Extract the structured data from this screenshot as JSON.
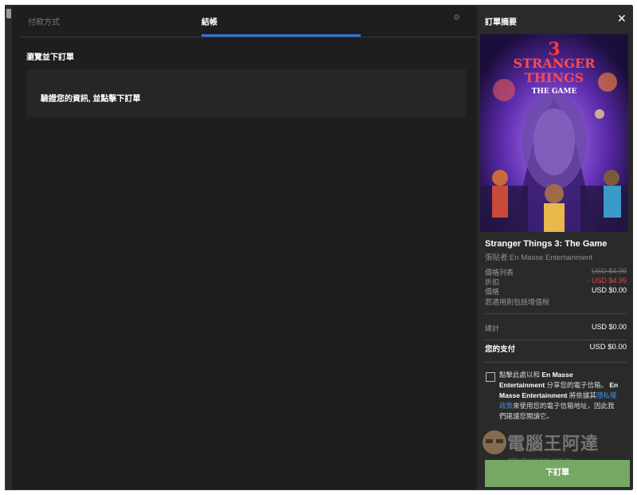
{
  "tabs": {
    "payment_method": "付款方式",
    "checkout": "結帳"
  },
  "main": {
    "section_title": "瀏覽並下訂單",
    "verify_text": "驗證您的資訊, 並點擊下訂單"
  },
  "sidebar": {
    "title": "訂單摘要",
    "close_icon": "close-icon",
    "game_title": "Stranger Things 3: The Game",
    "publisher": "張貼者:En Masse Entertainment",
    "list_price_label": "價格列表",
    "list_price_value": "USD $4.99",
    "discount_label": "折扣",
    "discount_value": "- USD $4.99",
    "price_label": "價格",
    "price_value": "USD $0.00",
    "vat_note": "若適用則包括增值稅",
    "total_label": "總計",
    "total_value": "USD $0.00",
    "pay_label": "您的支付",
    "pay_value": "USD $0.00",
    "consent_part1": "點擊此處以和 ",
    "consent_company1": "En Masse Entertainment",
    "consent_part2": " 分享您的電子信箱。 ",
    "consent_company2": "En Masse Entertainment",
    "consent_part3": " 將依據其",
    "consent_link": "隱私權政策",
    "consent_part4": "來使用您的電子信箱地址，因此我們建議您閱讀它。",
    "order_button": "下訂單"
  },
  "cover": {
    "line1": "STRANGER",
    "line2": "THINGS",
    "line3": "THE GAME",
    "number": "3"
  },
  "watermark": {
    "text": "電腦王阿達",
    "url": "http://www.koc.com.tw"
  },
  "colors": {
    "accent_blue": "#2e78d8",
    "button_green": "#75a864",
    "discount_red": "#d94a4a"
  }
}
